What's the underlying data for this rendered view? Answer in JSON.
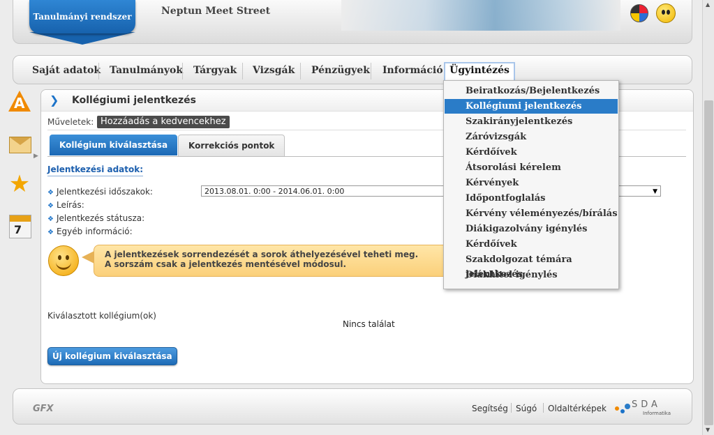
{
  "header": {
    "brand": "Tanulmányi rendszer",
    "site_title": "Neptun Meet Street"
  },
  "nav": {
    "items": [
      "Saját adatok",
      "Tanulmányok",
      "Tárgyak",
      "Vizsgák",
      "Pénzügyek",
      "Információ",
      "Ügyintézés"
    ],
    "active": "Ügyintézés"
  },
  "sidebar": {
    "calendar_day": "7",
    "icons": [
      "a-letter-icon",
      "mail-icon",
      "star-icon",
      "calendar-icon"
    ]
  },
  "panel": {
    "title": "Kollégiumi jelentkezés",
    "operations_label": "Műveletek:",
    "favorite_button": "Hozzáadás a kedvencekhez",
    "tabs": [
      "Kollégium kiválasztása",
      "Korrekciós pontok"
    ],
    "active_tab": "Kollégium kiválasztása",
    "section_title": "Jelentkezési adatok:",
    "fields": {
      "period_label": "Jelentkezési időszakok:",
      "period_value": "2013.08.01. 0:00 - 2014.06.01. 0:00",
      "description_label": "Leírás:",
      "status_label": "Jelentkezés státusza:",
      "other_label": "Egyéb információ:"
    },
    "hint": {
      "line1": "A jelentkezések sorrendezését a sorok áthelyezésével teheti meg.",
      "line2": "A sorszám csak a jelentkezés mentésével módosul."
    },
    "selected_label": "Kiválasztott kollégium(ok)",
    "no_result": "Nincs találat",
    "new_button": "Új kollégium kiválasztása"
  },
  "dropdown": {
    "items": [
      "Beiratkozás/Bejelentkezés",
      "Kollégiumi jelentkezés",
      "Szakirányjelentkezés",
      "Záróvizsgák",
      "Kérdőívek",
      "Átsorolási kérelem",
      "Kérvények",
      "Időpontfoglalás",
      "Kérvény véleményezés/bírálás",
      "Diákigazolvány igénylés",
      "Kérdőívek",
      "Szakdolgozat témára jelentkezés",
      "Diákhitel igénylés"
    ],
    "active": "Kollégiumi jelentkezés"
  },
  "footer": {
    "links": [
      "Segítség",
      "Súgó",
      "Oldaltérképek"
    ],
    "gfx_logo": "GFX",
    "sda_logo": "SDA",
    "sda_sub": "Informatika"
  },
  "colors": {
    "accent": "#1c73c9",
    "menu_highlight": "#2a7cc8",
    "hint_bg": "#fbd07a"
  }
}
